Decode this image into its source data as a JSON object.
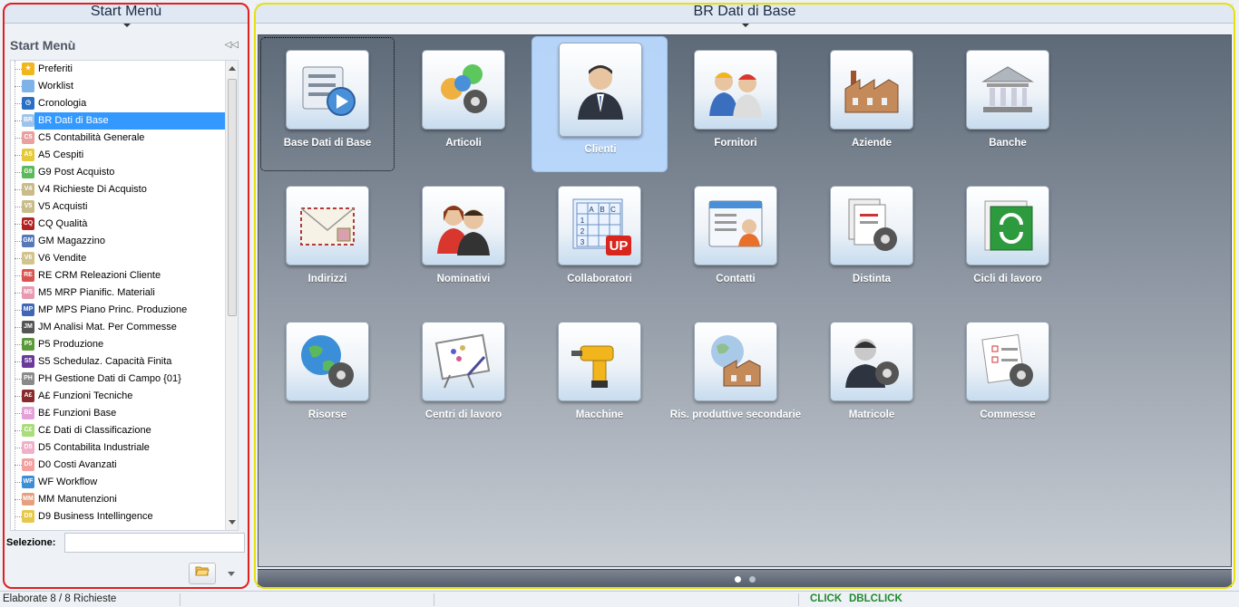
{
  "left_panel": {
    "header": "Start Menù",
    "title": "Start Menù",
    "selection_label": "Selezione:",
    "selection_value": "",
    "tree_items": [
      {
        "code": "★",
        "label": "Preferiti",
        "color": "#f2b51b"
      },
      {
        "code": "",
        "label": "Worklist",
        "color": "#7fb3e8"
      },
      {
        "code": "◷",
        "label": "Cronologia",
        "color": "#2a6fc4"
      },
      {
        "code": "BR",
        "label": "BR Dati di Base",
        "color": "#9ec3ea",
        "selected": true
      },
      {
        "code": "C5",
        "label": "C5 Contabilità Generale",
        "color": "#e8a0a0"
      },
      {
        "code": "A5",
        "label": "A5 Cespiti",
        "color": "#e6c93a"
      },
      {
        "code": "G9",
        "label": "G9 Post Acquisto",
        "color": "#5bb85b"
      },
      {
        "code": "V4",
        "label": "V4 Richieste Di Acquisto",
        "color": "#c9bc8a"
      },
      {
        "code": "V5",
        "label": "V5 Acquisti",
        "color": "#c9bc8a"
      },
      {
        "code": "CQ",
        "label": "CQ Qualità",
        "color": "#b22222"
      },
      {
        "code": "GM",
        "label": "GM Magazzino",
        "color": "#5578b8"
      },
      {
        "code": "V6",
        "label": "V6 Vendite",
        "color": "#d1c48e"
      },
      {
        "code": "RE",
        "label": "RE CRM Releazioni Cliente",
        "color": "#d9534f"
      },
      {
        "code": "M5",
        "label": "M5 MRP Pianific. Materiali",
        "color": "#e79ab0"
      },
      {
        "code": "MP",
        "label": "MP MPS Piano Princ. Produzione",
        "color": "#3f67b5"
      },
      {
        "code": "JM",
        "label": "JM Analisi Mat. Per Commesse",
        "color": "#555"
      },
      {
        "code": "P5",
        "label": "P5 Produzione",
        "color": "#5a9a3a"
      },
      {
        "code": "S5",
        "label": "S5 Schedulaz. Capacità Finita",
        "color": "#6a3a9a"
      },
      {
        "code": "PH",
        "label": "PH Gestione Dati di Campo {01}",
        "color": "#8a8a8a"
      },
      {
        "code": "A£",
        "label": "A£ Funzioni Tecniche",
        "color": "#8b2a2a"
      },
      {
        "code": "B£",
        "label": "B£ Funzioni Base",
        "color": "#e3a1d8"
      },
      {
        "code": "C£",
        "label": "C£ Dati di Classificazione",
        "color": "#a9dc7a"
      },
      {
        "code": "D5",
        "label": "D5 Contabilita Industriale",
        "color": "#f0b0c8"
      },
      {
        "code": "D0",
        "label": "D0 Costi Avanzati",
        "color": "#f2a0a0"
      },
      {
        "code": "WF",
        "label": "WF Workflow",
        "color": "#3a8fd8"
      },
      {
        "code": "MM",
        "label": "MM Manutenzioni",
        "color": "#e6a080"
      },
      {
        "code": "D9",
        "label": "D9 Business Intellingence",
        "color": "#e8c84a"
      }
    ]
  },
  "right_panel": {
    "header": "BR Dati di Base",
    "tiles": [
      {
        "label": "Base Dati di Base",
        "icon": "list-play-icon",
        "state": "focused"
      },
      {
        "label": "Articoli",
        "icon": "shapes-gear-icon"
      },
      {
        "label": "Clienti",
        "icon": "businessman-icon",
        "state": "hovered"
      },
      {
        "label": "Fornitori",
        "icon": "workers-icon"
      },
      {
        "label": "Aziende",
        "icon": "factory-icon"
      },
      {
        "label": "Banche",
        "icon": "bank-icon"
      },
      {
        "label": "Indirizzi",
        "icon": "envelope-icon"
      },
      {
        "label": "Nominativi",
        "icon": "people-icon"
      },
      {
        "label": "Collaboratori",
        "icon": "grid-up-icon",
        "badge": "UP"
      },
      {
        "label": "Contatti",
        "icon": "contact-card-icon"
      },
      {
        "label": "Distinta",
        "icon": "documents-gear-icon"
      },
      {
        "label": "Cicli di lavoro",
        "icon": "cycle-icon"
      },
      {
        "label": "Risorse",
        "icon": "globe-gear-icon"
      },
      {
        "label": "Centri di lavoro",
        "icon": "whiteboard-icon"
      },
      {
        "label": "Macchine",
        "icon": "drill-icon"
      },
      {
        "label": "Ris. produttive secondarie",
        "icon": "globe-factory-icon"
      },
      {
        "label": "Matricole",
        "icon": "person-gear-icon"
      },
      {
        "label": "Commesse",
        "icon": "checklist-gear-icon"
      }
    ],
    "grid_table": {
      "a": "A",
      "b": "B",
      "c": "C",
      "r1": "1",
      "r2": "2",
      "r3": "3"
    },
    "pager": {
      "pages": 2,
      "current": 1
    }
  },
  "status": {
    "left": "Elaborate 8 / 8 Richieste",
    "click": "CLICK",
    "dblclick": "DBLCLICK",
    "accent": "#1f8a2e"
  }
}
